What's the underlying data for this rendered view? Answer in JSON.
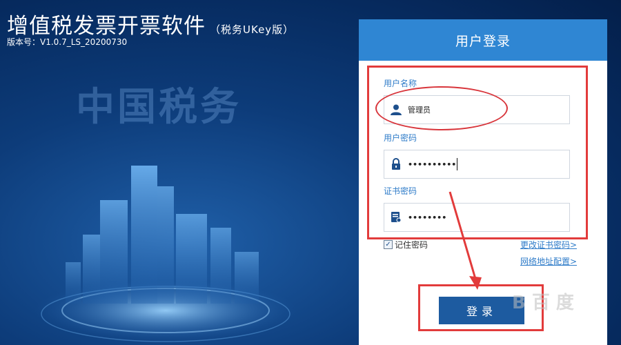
{
  "app": {
    "title": "增值税发票开票软件",
    "title_suffix": "（税务UKey版）",
    "version": "版本号：V1.0.7_LS_20200730",
    "background_mark": "中国税务"
  },
  "login": {
    "panel_title": "用户登录",
    "username_label": "用户名称",
    "username_value": "管理员",
    "password_label": "用户密码",
    "password_value": "••••••••••",
    "cert_password_label": "证书密码",
    "cert_password_value": "••••••••",
    "remember_label": "记住密码",
    "remember_checked": "✓",
    "change_cert_link": "更改证书密码>",
    "network_config_link": "网络地址配置>",
    "login_button": "登录"
  },
  "icons": {
    "user": "user-icon",
    "lock": "lock-icon",
    "certificate": "certificate-icon"
  },
  "colors": {
    "background": "#0d3c7a",
    "header_blue": "#2f86d3",
    "button_blue": "#1d5ba0",
    "label_blue": "#2f7cc9",
    "annotation_red": "#e23b3b"
  },
  "watermark": "B 百 度"
}
